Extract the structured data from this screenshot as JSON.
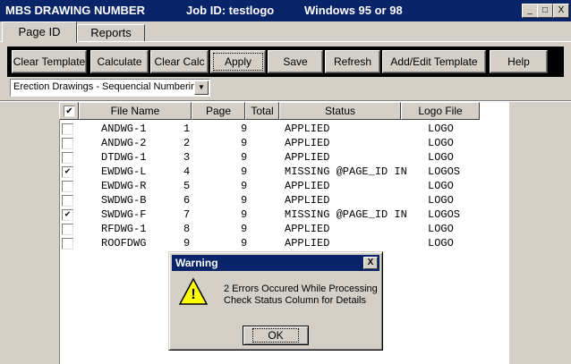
{
  "window": {
    "title": "MBS DRAWING NUMBER",
    "job": "Job ID: testlogo",
    "os": "Windows 95 or 98",
    "buttons": {
      "minimize": "_",
      "maximize": "□",
      "close": "X"
    }
  },
  "tabs": [
    {
      "label": "Page ID",
      "active": true
    },
    {
      "label": "Reports",
      "active": false
    }
  ],
  "toolbar": {
    "buttons": [
      "Clear Template",
      "Calculate",
      "Clear Calc",
      "Apply",
      "Save",
      "Refresh",
      "Add/Edit Template",
      "Help"
    ]
  },
  "dropdown": {
    "selected": "Erection Drawings - Sequencial Numbering",
    "arrow": "▼"
  },
  "grid": {
    "header_check": "✔",
    "columns": [
      "File Name",
      "Page",
      "Total",
      "Status",
      "Logo File"
    ],
    "rows": [
      {
        "checked": false,
        "file": "ANDWG-1",
        "page": "1",
        "total": "9",
        "status": "APPLIED",
        "logo": "LOGO"
      },
      {
        "checked": false,
        "file": "ANDWG-2",
        "page": "2",
        "total": "9",
        "status": "APPLIED",
        "logo": "LOGO"
      },
      {
        "checked": false,
        "file": "DTDWG-1",
        "page": "3",
        "total": "9",
        "status": "APPLIED",
        "logo": "LOGO"
      },
      {
        "checked": true,
        "file": "EWDWG-L",
        "page": "4",
        "total": "9",
        "status": "MISSING @PAGE_ID IN",
        "logo": "LOGOS"
      },
      {
        "checked": false,
        "file": "EWDWG-R",
        "page": "5",
        "total": "9",
        "status": "APPLIED",
        "logo": "LOGO"
      },
      {
        "checked": false,
        "file": "SWDWG-B",
        "page": "6",
        "total": "9",
        "status": "APPLIED",
        "logo": "LOGO"
      },
      {
        "checked": true,
        "file": "SWDWG-F",
        "page": "7",
        "total": "9",
        "status": "MISSING @PAGE_ID IN",
        "logo": "LOGOS"
      },
      {
        "checked": false,
        "file": "RFDWG-1",
        "page": "8",
        "total": "9",
        "status": "APPLIED",
        "logo": "LOGO"
      },
      {
        "checked": false,
        "file": "ROOFDWG",
        "page": "9",
        "total": "9",
        "status": "APPLIED",
        "logo": "LOGO"
      }
    ]
  },
  "dialog": {
    "title": "Warning",
    "close": "X",
    "icon": "warning-icon",
    "icon_glyph": "!",
    "line1": "2 Errors Occured While Processing",
    "line2": "Check Status Column for Details",
    "ok": "OK"
  },
  "colors": {
    "titlebar": "#0a246a",
    "face": "#d4d0c8",
    "warning_yellow": "#ffff00"
  }
}
